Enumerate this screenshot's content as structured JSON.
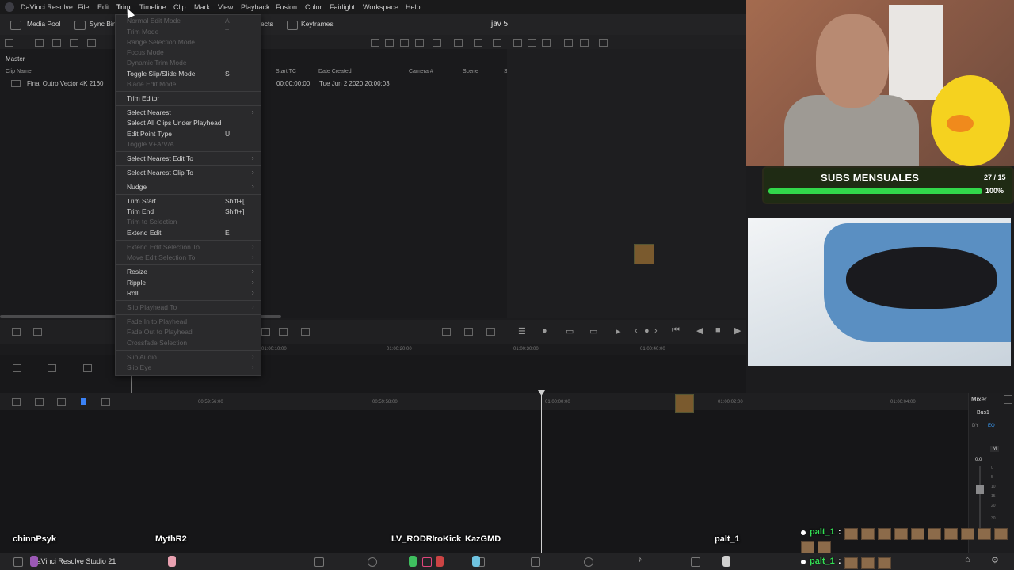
{
  "menubar": {
    "app_name": "DaVinci Resolve",
    "items": [
      "File",
      "Edit",
      "Trim",
      "Timeline",
      "Clip",
      "Mark",
      "View",
      "Playback",
      "Fusion",
      "Color",
      "Fairlight",
      "Workspace",
      "Help"
    ]
  },
  "toolbar": {
    "media_pool": "Media Pool",
    "sync_bin": "Sync Bin",
    "effects": "ects",
    "keyframes": "Keyframes",
    "project_title": "jav 5"
  },
  "media_pool": {
    "bin": "Master",
    "columns": [
      "Clip Name",
      "Start TC",
      "Date Created",
      "Camera #",
      "Scene",
      "S"
    ],
    "rows": [
      {
        "clip_name": "Final Outro Vector 4K 2160",
        "start_tc": "00:00:00:00",
        "date_created": "Tue Jun 2 2020 20:00:03"
      }
    ]
  },
  "trim_menu": {
    "items": [
      {
        "label": "Normal Edit Mode",
        "shortcut": "A",
        "disabled": true,
        "submenu": false
      },
      {
        "label": "Trim Mode",
        "shortcut": "T",
        "disabled": true,
        "submenu": false
      },
      {
        "label": "Range Selection Mode",
        "shortcut": "",
        "disabled": true,
        "submenu": false
      },
      {
        "label": "Focus Mode",
        "shortcut": "",
        "disabled": true,
        "submenu": false
      },
      {
        "label": "Dynamic Trim Mode",
        "shortcut": "",
        "disabled": true,
        "submenu": false
      },
      {
        "label": "Toggle Slip/Slide Mode",
        "shortcut": "S",
        "disabled": false,
        "submenu": false
      },
      {
        "label": "Blade Edit Mode",
        "shortcut": "",
        "disabled": true,
        "submenu": false
      },
      {
        "label": "Trim Editor",
        "shortcut": "",
        "disabled": false,
        "submenu": false
      },
      {
        "label": "Select Nearest",
        "shortcut": "",
        "disabled": false,
        "submenu": true
      },
      {
        "label": "Select All Clips Under Playhead",
        "shortcut": "",
        "disabled": false,
        "submenu": false
      },
      {
        "label": "Edit Point Type",
        "shortcut": "U",
        "disabled": false,
        "submenu": false
      },
      {
        "label": "Toggle V+A/V/A",
        "shortcut": "",
        "disabled": true,
        "submenu": false
      },
      {
        "label": "Select Nearest Edit To",
        "shortcut": "",
        "disabled": false,
        "submenu": true
      },
      {
        "label": "Select Nearest Clip To",
        "shortcut": "",
        "disabled": false,
        "submenu": true
      },
      {
        "label": "Nudge",
        "shortcut": "",
        "disabled": false,
        "submenu": true
      },
      {
        "label": "Trim Start",
        "shortcut": "Shift+[",
        "disabled": false,
        "submenu": false
      },
      {
        "label": "Trim End",
        "shortcut": "Shift+]",
        "disabled": false,
        "submenu": false
      },
      {
        "label": "Trim to Selection",
        "shortcut": "",
        "disabled": true,
        "submenu": false
      },
      {
        "label": "Extend Edit",
        "shortcut": "E",
        "disabled": false,
        "submenu": false
      },
      {
        "label": "Extend Edit Selection To",
        "shortcut": "",
        "disabled": true,
        "submenu": true
      },
      {
        "label": "Move Edit Selection To",
        "shortcut": "",
        "disabled": true,
        "submenu": true
      },
      {
        "label": "Resize",
        "shortcut": "",
        "disabled": false,
        "submenu": true
      },
      {
        "label": "Ripple",
        "shortcut": "",
        "disabled": false,
        "submenu": true
      },
      {
        "label": "Roll",
        "shortcut": "",
        "disabled": false,
        "submenu": true
      },
      {
        "label": "Slip Playhead To",
        "shortcut": "",
        "disabled": true,
        "submenu": true
      },
      {
        "label": "Fade In to Playhead",
        "shortcut": "",
        "disabled": true,
        "submenu": false
      },
      {
        "label": "Fade Out to Playhead",
        "shortcut": "",
        "disabled": true,
        "submenu": false
      },
      {
        "label": "Crossfade Selection",
        "shortcut": "",
        "disabled": true,
        "submenu": false
      },
      {
        "label": "Slip Audio",
        "shortcut": "",
        "disabled": true,
        "submenu": true
      },
      {
        "label": "Slip Eye",
        "shortcut": "",
        "disabled": true,
        "submenu": true
      }
    ]
  },
  "ruler": {
    "upper": [
      "01:00:10:00",
      "01:00:20:00",
      "01:00:30:00",
      "01:00:40:00"
    ],
    "lower": [
      "00:59:56:00",
      "00:59:58:00",
      "01:00:00:00",
      "01:00:02:00",
      "01:00:04:00"
    ]
  },
  "mixer": {
    "title": "Mixer",
    "bus": "Bus1",
    "dy": "DY",
    "eq": "EQ",
    "m": "M",
    "level": "0.0",
    "scale": [
      "0",
      "5",
      "10",
      "15",
      "20",
      "30"
    ]
  },
  "bottom_bar": {
    "app_label": "DaVinci Resolve Studio 21"
  },
  "overlay": {
    "subs_title": "SUBS MENSUALES",
    "subs_count": "27 / 15",
    "subs_progress": 1.0,
    "subs_pct": "100%",
    "viewers": [
      "chinnPsyk",
      "MythR2",
      "LV_RODRI",
      "roKick",
      "KazGMD",
      "palt_1"
    ],
    "chat": [
      {
        "user": "palt_1",
        "sep": ":"
      },
      {
        "user": "palt_1",
        "sep": ":"
      }
    ]
  }
}
